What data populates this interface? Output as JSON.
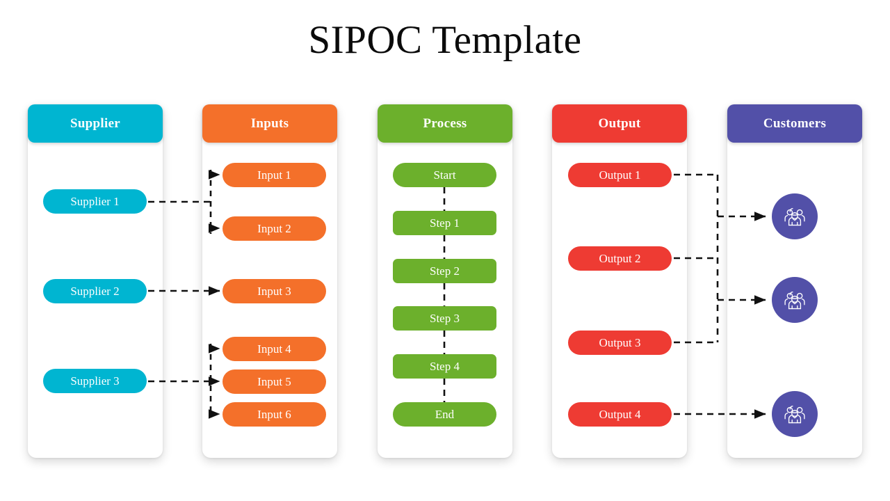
{
  "title": "SIPOC Template",
  "colors": {
    "supplier": "#00b5d1",
    "inputs": "#f4702a",
    "process": "#6cb02c",
    "output": "#ee3b33",
    "customers": "#5250a8",
    "card": "#ffffff",
    "background": "#ffffff",
    "connector": "#111111",
    "title_text": "#0b0b0b",
    "header_text": "#ffffff"
  },
  "columns": [
    {
      "key": "supplier",
      "header": "Supplier",
      "color": "#00b5d1"
    },
    {
      "key": "inputs",
      "header": "Inputs",
      "color": "#f4702a"
    },
    {
      "key": "process",
      "header": "Process",
      "color": "#6cb02c"
    },
    {
      "key": "output",
      "header": "Output",
      "color": "#ee3b33"
    },
    {
      "key": "customers",
      "header": "Customers",
      "color": "#5250a8"
    }
  ],
  "suppliers": [
    {
      "label": "Supplier 1"
    },
    {
      "label": "Supplier 2"
    },
    {
      "label": "Supplier 3"
    }
  ],
  "inputs": [
    {
      "label": "Input 1"
    },
    {
      "label": "Input 2"
    },
    {
      "label": "Input 3"
    },
    {
      "label": "Input 4"
    },
    {
      "label": "Input 5"
    },
    {
      "label": "Input 6"
    }
  ],
  "process_steps": [
    {
      "label": "Start",
      "shape": "pill"
    },
    {
      "label": "Step 1",
      "shape": "rect"
    },
    {
      "label": "Step 2",
      "shape": "rect"
    },
    {
      "label": "Step 3",
      "shape": "rect"
    },
    {
      "label": "Step 4",
      "shape": "rect"
    },
    {
      "label": "End",
      "shape": "pill"
    }
  ],
  "outputs": [
    {
      "label": "Output 1"
    },
    {
      "label": "Output 2"
    },
    {
      "label": "Output 3"
    },
    {
      "label": "Output 4"
    }
  ],
  "customers": [
    {
      "icon": "people-group-icon"
    },
    {
      "icon": "people-group-icon"
    },
    {
      "icon": "people-group-icon"
    }
  ],
  "connections": {
    "supplier_to_inputs": [
      {
        "from": "Supplier 1",
        "to": [
          "Input 1",
          "Input 2"
        ]
      },
      {
        "from": "Supplier 2",
        "to": [
          "Input 3"
        ]
      },
      {
        "from": "Supplier 3",
        "to": [
          "Input 4",
          "Input 5",
          "Input 6"
        ]
      }
    ],
    "process_chain": [
      "Start",
      "Step 1",
      "Step 2",
      "Step 3",
      "Step 4",
      "End"
    ],
    "output_to_customers": [
      {
        "from": [
          "Output 1",
          "Output 2",
          "Output 3"
        ],
        "to": [
          "Customer 1",
          "Customer 2"
        ]
      },
      {
        "from": [
          "Output 4"
        ],
        "to": [
          "Customer 3"
        ]
      }
    ]
  }
}
